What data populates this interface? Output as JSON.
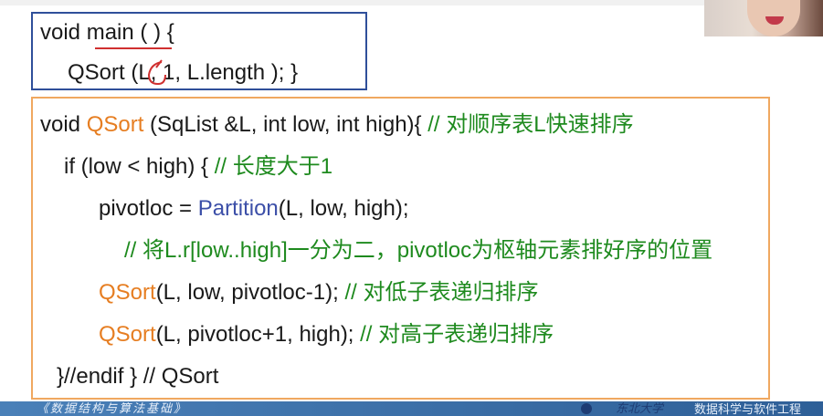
{
  "main_box": {
    "line1": [
      "void ",
      "main",
      " ( ) {"
    ],
    "line2": [
      "QSort (",
      "L",
      ", 1, L.length ); }"
    ]
  },
  "qsort_box": {
    "line1": [
      "void ",
      "QSort",
      " (SqList &L, int low, int high){  ",
      "// 对顺序表L快速排序"
    ],
    "line2": [
      "if (low < high) {  ",
      "// 长度大于1"
    ],
    "line3": [
      "pivotloc = ",
      "Partition",
      "(L, low, high);"
    ],
    "line4": [
      "// 将L.r[low..high]一分为二，pivotloc为枢轴元素排好序的位置"
    ],
    "line5": [
      "QSort",
      "(L, low, pivotloc-1);   ",
      "// 对低子表递归排序"
    ],
    "line6": [
      "QSort",
      "(L, pivotloc+1, high); ",
      "// 对高子表递归排序"
    ],
    "line7": [
      "}//endif  } // QSort"
    ]
  },
  "colors": {
    "keyword_orange": "#e67e22",
    "function_blue": "#3c4fa8",
    "comment_green": "#1e8a1e",
    "main_border": "#2f4f9a",
    "qsort_border": "#f0a860",
    "annotation_red": "#d03030",
    "bottom_bar": "#3a6ea8"
  },
  "bottom_bar": {
    "left_text": "《数据结构与算法基础》",
    "logo_text": "东北大学",
    "right_text": "数据科学与软件工程"
  },
  "webcam": {
    "icon": "presenter-video"
  }
}
